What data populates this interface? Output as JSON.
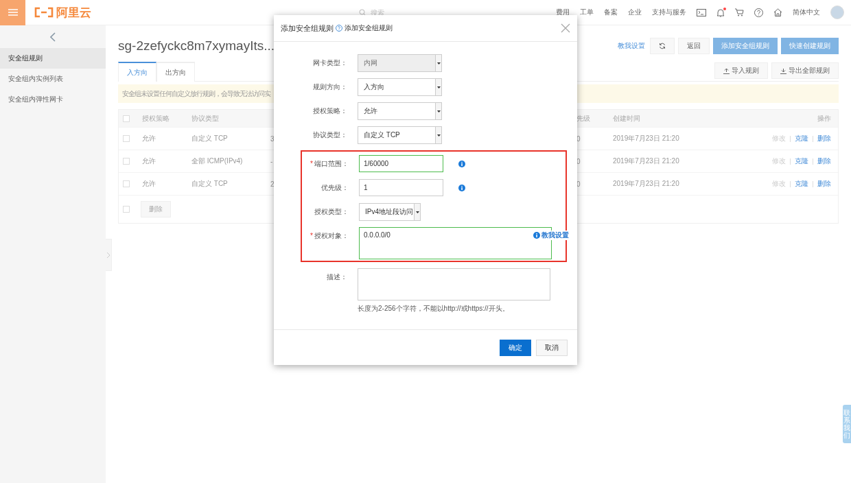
{
  "header": {
    "logo": "阿里云",
    "search": {
      "placeholder": "搜索"
    },
    "nav": [
      "费用",
      "工单",
      "备案",
      "企业",
      "支持与服务"
    ],
    "notification_dot": true,
    "language": "简体中文"
  },
  "sidebar": {
    "items": [
      {
        "label": "安全组规则",
        "selected": true
      },
      {
        "label": "安全组内实例列表",
        "selected": false
      },
      {
        "label": "安全组内弹性网卡",
        "selected": false
      }
    ]
  },
  "page": {
    "title": "sg-2zefyckc8m7xymayIts...",
    "help_link": "教我设置",
    "back_button": "返回",
    "primary_buttons": [
      "添加安全组规则",
      "快速创建规则"
    ],
    "tabs": [
      {
        "label": "入方向",
        "selected": true
      },
      {
        "label": "出方向",
        "selected": false
      }
    ],
    "import_button": "导入规则",
    "export_button": "导出全部规则",
    "alert": "安全组未设置任何自定义放行规则，会导致无法访问实",
    "table": {
      "header_checked": false,
      "headers": {
        "policy": "授权策略",
        "protocol": "协议类型",
        "priority": "先级",
        "created": "创建时间",
        "actions": "操作"
      },
      "rows": [
        {
          "checked": false,
          "policy": "允许",
          "protocol": "自定义 TCP",
          "column_3": "3",
          "priority": "0",
          "created": "2019年7月23日 21:20",
          "actions": [
            {
              "label": "修改",
              "disabled": true
            },
            {
              "label": "克隆",
              "disabled": false
            },
            {
              "label": "删除",
              "disabled": false
            }
          ]
        },
        {
          "checked": false,
          "policy": "允许",
          "protocol": "全部 ICMP(IPv4)",
          "column_3": "-",
          "priority": "0",
          "created": "2019年7月23日 21:20",
          "actions": [
            {
              "label": "修改",
              "disabled": true
            },
            {
              "label": "克隆",
              "disabled": false
            },
            {
              "label": "删除",
              "disabled": false
            }
          ]
        },
        {
          "checked": false,
          "policy": "允许",
          "protocol": "自定义 TCP",
          "column_3": "2",
          "priority": "0",
          "created": "2019年7月23日 21:20",
          "actions": [
            {
              "label": "修改",
              "disabled": true
            },
            {
              "label": "克隆",
              "disabled": false
            },
            {
              "label": "删除",
              "disabled": false
            }
          ]
        }
      ],
      "footer_checked": false,
      "bulk_delete": {
        "label": "删除",
        "disabled": true
      }
    }
  },
  "modal": {
    "title": "添加安全组规则",
    "help": "添加安全组规则",
    "required_mark": "*",
    "rows": [
      {
        "kind": "select",
        "label": "网卡类型：",
        "value": "内网",
        "disabled": true,
        "required": false,
        "highlighted": false
      },
      {
        "kind": "select",
        "label": "规则方向：",
        "value": "入方向",
        "disabled": false,
        "required": false,
        "highlighted": false
      },
      {
        "kind": "select",
        "label": "授权策略：",
        "value": "允许",
        "disabled": false,
        "required": false,
        "highlighted": false
      },
      {
        "kind": "select",
        "label": "协议类型：",
        "value": "自定义 TCP",
        "disabled": false,
        "required": false,
        "highlighted": false
      },
      {
        "kind": "input",
        "label": "端口范围：",
        "value": "1/60000",
        "required": true,
        "valid": true,
        "info": true,
        "highlighted": true
      },
      {
        "kind": "input",
        "label": "优先级：",
        "value": "1",
        "required": false,
        "valid": false,
        "info": true,
        "highlighted": true
      },
      {
        "kind": "short-select",
        "label": "授权类型：",
        "value": "IPv4地址段访问",
        "disabled": false,
        "required": false,
        "highlighted": true
      },
      {
        "kind": "textarea",
        "label": "授权对象：",
        "value": "0.0.0.0/0",
        "required": true,
        "valid": true,
        "link": "教我设置",
        "highlighted": true
      },
      {
        "kind": "textarea",
        "label": "描述：",
        "required": false,
        "valid": false,
        "hint": "长度为2-256个字符，不能以http://或https://开头。",
        "highlighted": false
      }
    ],
    "buttons": [
      {
        "label": "确定",
        "primary": true
      },
      {
        "label": "取消",
        "primary": false
      }
    ]
  },
  "contact_tab": "联系我们"
}
